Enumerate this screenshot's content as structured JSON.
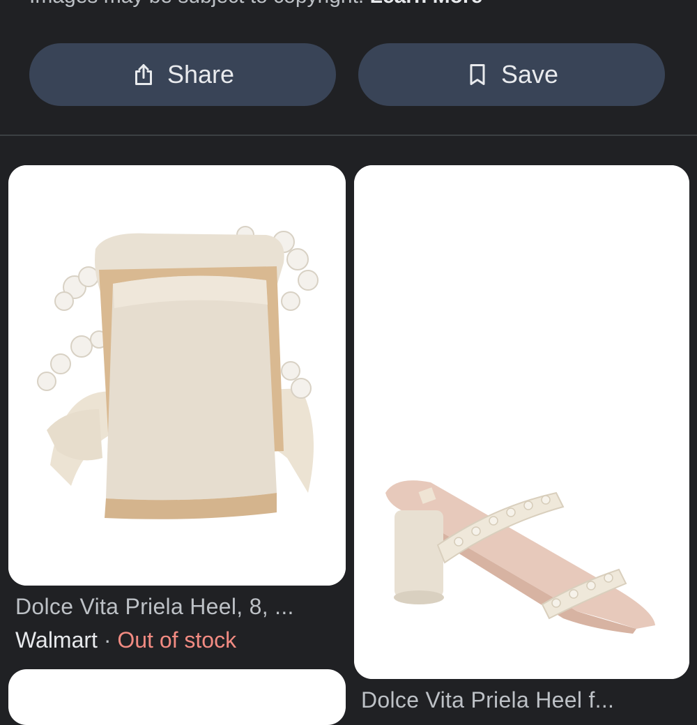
{
  "notice": {
    "text": "Images may be subject to copyright.",
    "link": "Learn More"
  },
  "actions": {
    "share_label": "Share",
    "save_label": "Save",
    "share_icon": "share-icon",
    "save_icon": "bookmark-icon"
  },
  "results": [
    {
      "title": "Dolce Vita Priela Heel, 8, ...",
      "store": "Walmart",
      "separator": "·",
      "availability": "Out of stock"
    },
    {
      "title": "Dolce Vita Priela Heel f..."
    }
  ],
  "colors": {
    "background": "#202124",
    "button": "#394457",
    "out_of_stock": "#f28b82"
  }
}
